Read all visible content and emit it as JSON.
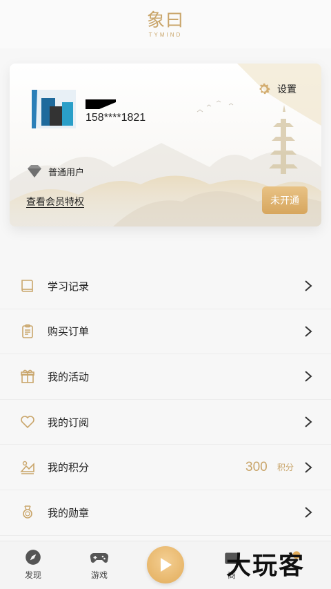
{
  "header": {
    "logo_text": "象曰",
    "logo_sub": "TYMIND"
  },
  "profile": {
    "phone": "158****1821",
    "settings_label": "设置",
    "level_label": "普通用户",
    "vip_link": "查看会员特权",
    "open_button": "未开通"
  },
  "menu": {
    "items": [
      {
        "label": "学习记录",
        "icon": "book-icon"
      },
      {
        "label": "购买订单",
        "icon": "clipboard-icon"
      },
      {
        "label": "我的活动",
        "icon": "gift-icon"
      },
      {
        "label": "我的订阅",
        "icon": "heart-icon"
      },
      {
        "label": "我的积分",
        "icon": "points-icon",
        "value": "300",
        "unit": "积分"
      },
      {
        "label": "我的勋章",
        "icon": "medal-icon"
      }
    ]
  },
  "tabbar": {
    "tabs": [
      {
        "label": "发现",
        "icon": "compass-icon"
      },
      {
        "label": "游戏",
        "icon": "gamepad-icon"
      },
      {
        "label": "",
        "icon": "play-icon"
      },
      {
        "label": "商",
        "icon": "shop-icon"
      },
      {
        "label": "",
        "icon": "user-icon"
      }
    ]
  },
  "watermark": "大玩客",
  "colors": {
    "accent": "#c9a56a",
    "button": "#dcaf6a"
  }
}
